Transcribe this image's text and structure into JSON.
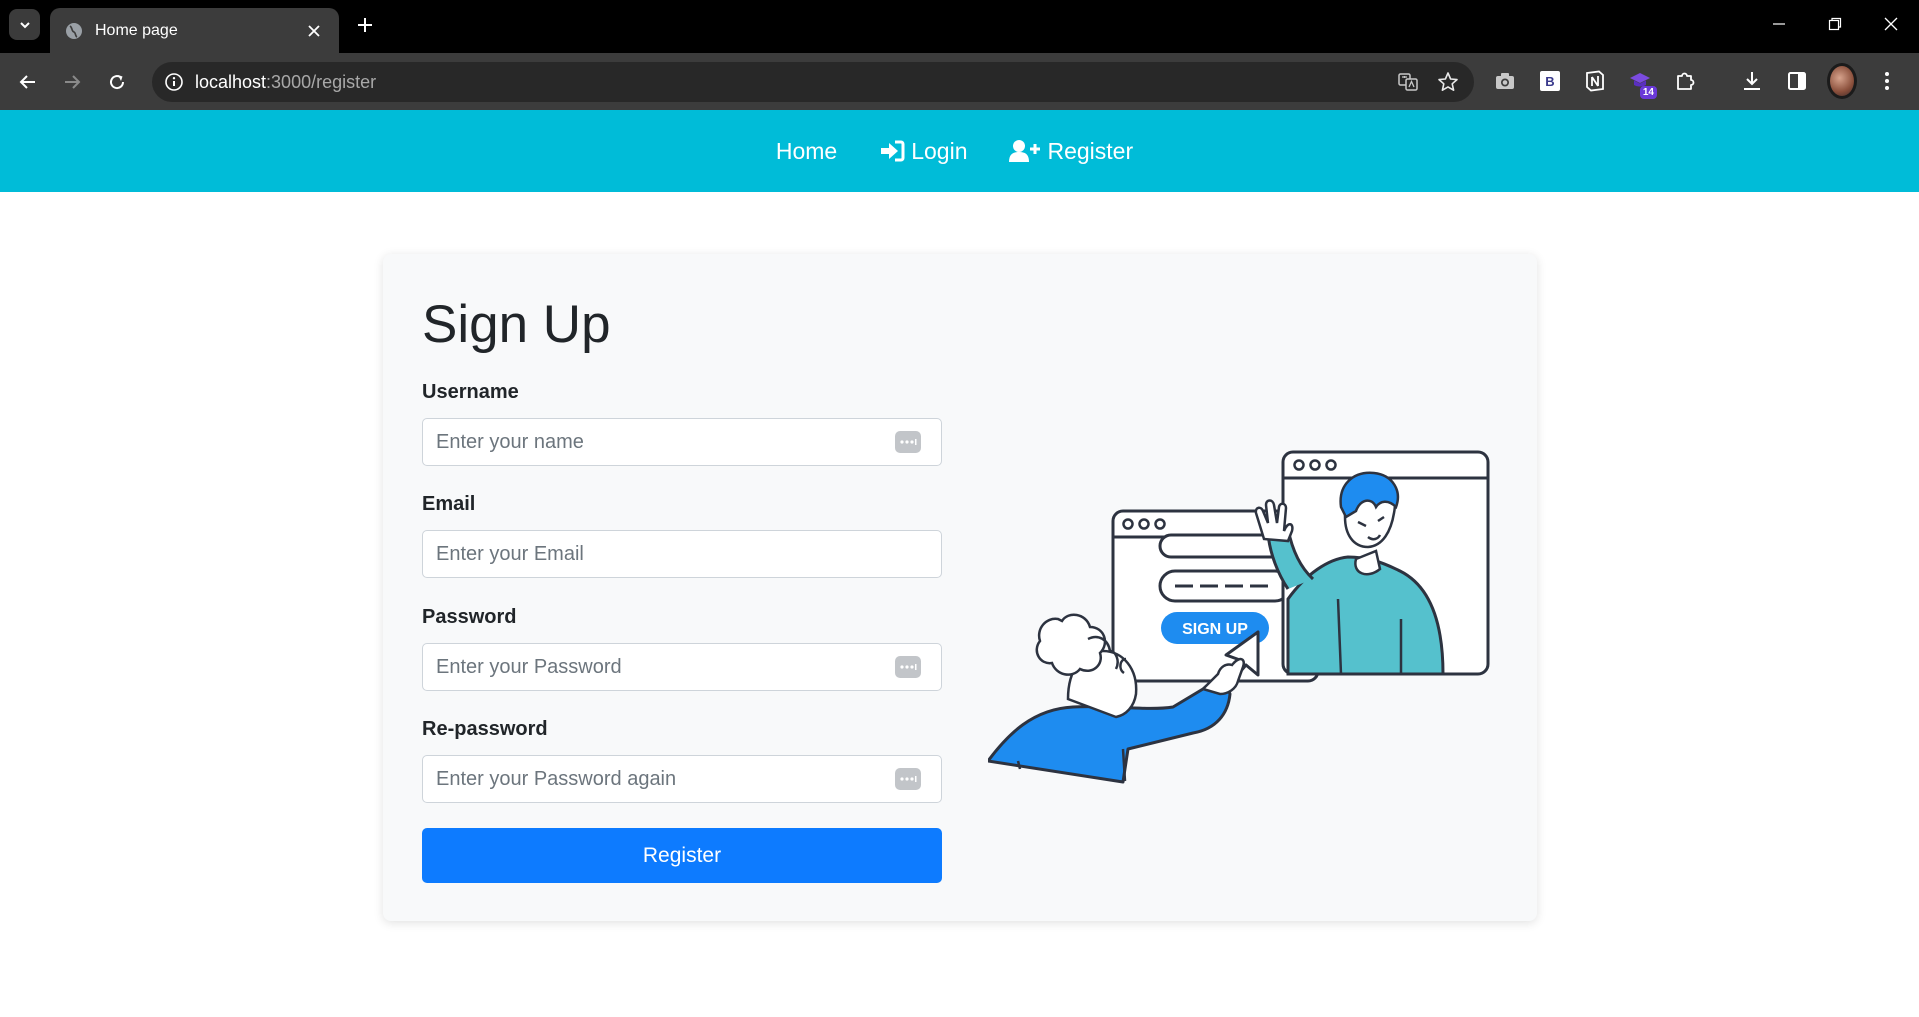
{
  "browser": {
    "tab_title": "Home page",
    "url_host": "localhost",
    "url_path": ":3000/register",
    "extension_badge": "14"
  },
  "nav": {
    "home": "Home",
    "login": "Login",
    "register": "Register"
  },
  "form": {
    "title": "Sign Up",
    "username_label": "Username",
    "username_placeholder": "Enter your name",
    "email_label": "Email",
    "email_placeholder": "Enter your Email",
    "password_label": "Password",
    "password_placeholder": "Enter your Password",
    "repassword_label": "Re-password",
    "repassword_placeholder": "Enter your Password again",
    "submit_label": "Register"
  },
  "illustration": {
    "button_text": "SIGN UP"
  },
  "colors": {
    "navbar": "#00bcd8",
    "primary": "#0d7bff",
    "illustration_blue": "#1e8cf0",
    "illustration_teal": "#55c1cd"
  }
}
